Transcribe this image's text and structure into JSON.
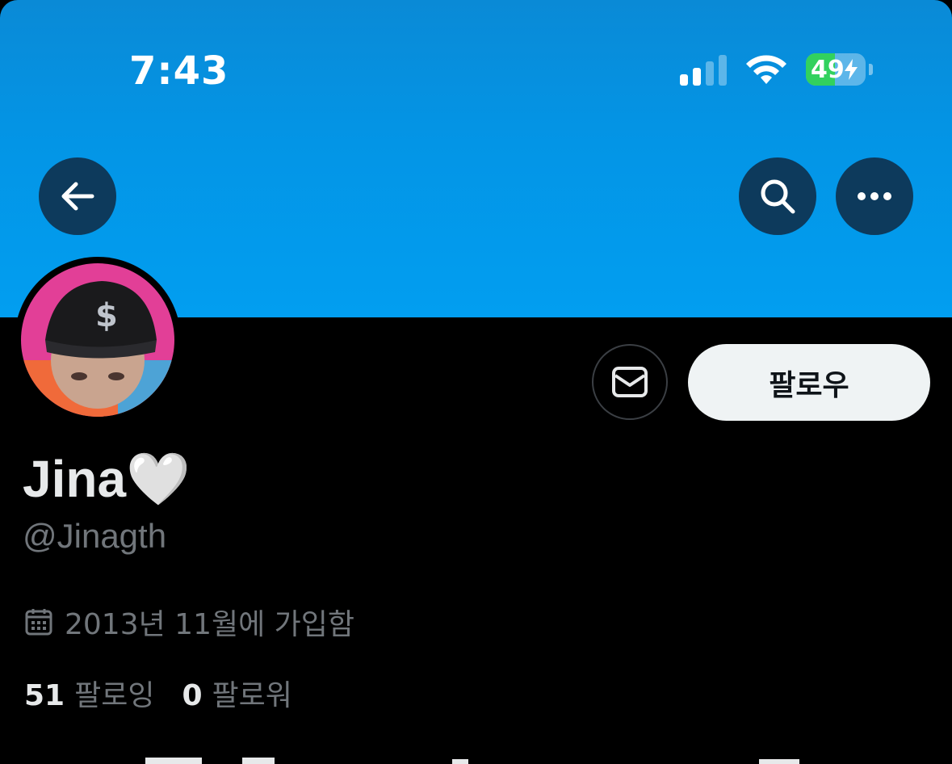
{
  "status_bar": {
    "time": "7:43",
    "battery_percent": "49",
    "battery_level": 0.49,
    "charging": true,
    "signal_bars_active": 2
  },
  "header": {
    "banner_color": "#0395e6",
    "back_icon": "arrow-left-icon",
    "search_icon": "search-icon",
    "more_icon": "more-horizontal-icon"
  },
  "profile": {
    "display_name": "Jina🤍",
    "handle": "@Jinagth",
    "joined": "2013년 11월에 가입함",
    "following_count": "51",
    "following_label": "팔로잉",
    "followers_count": "0",
    "followers_label": "팔로워"
  },
  "actions": {
    "message_icon": "mail-icon",
    "follow_label": "팔로우"
  }
}
